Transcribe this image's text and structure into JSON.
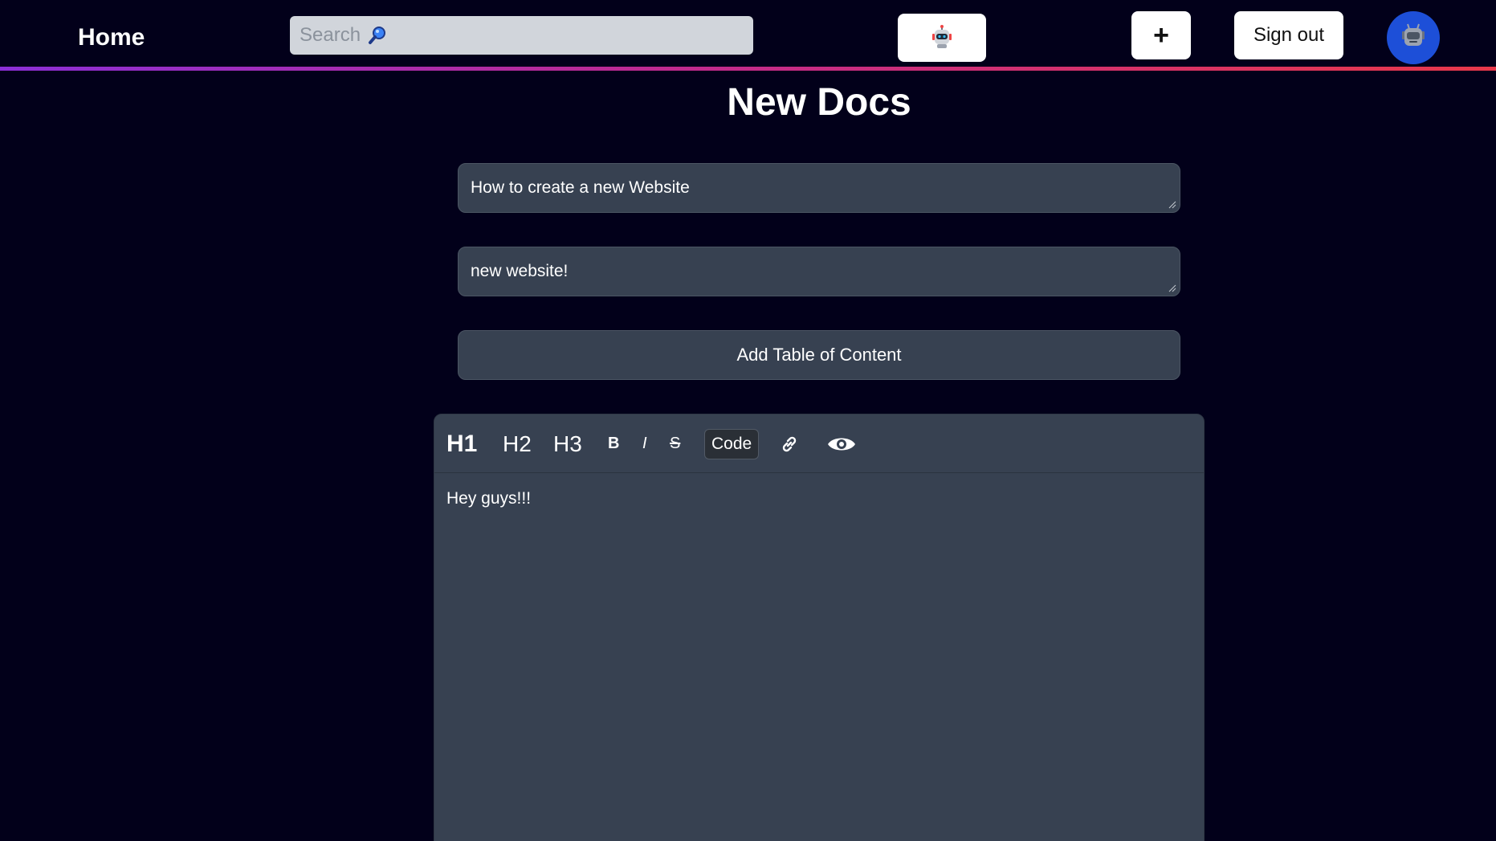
{
  "header": {
    "home_label": "Home",
    "search_placeholder": "Search",
    "plus_label": "+",
    "signout_label": "Sign out"
  },
  "main": {
    "title": "New Docs",
    "title_value": "How to create a new Website",
    "description_value": "new website!",
    "toc_button_label": "Add Table of Content"
  },
  "editor": {
    "toolbar": {
      "h1": "H1",
      "h2": "H2",
      "h3": "H3",
      "bold": "B",
      "italic": "I",
      "strike": "S",
      "code": "Code"
    },
    "content": "Hey guys!!!"
  },
  "icons": {
    "search": "magnifier-icon",
    "bot": "robot-icon",
    "avatar": "robot-avatar-icon",
    "link": "link-icon",
    "preview": "eye-icon"
  },
  "colors": {
    "background": "#02001a",
    "panel": "#374151",
    "avatar_bg": "#1d4fd8",
    "gradient_start": "#8b2fd6",
    "gradient_end": "#e8384a"
  }
}
